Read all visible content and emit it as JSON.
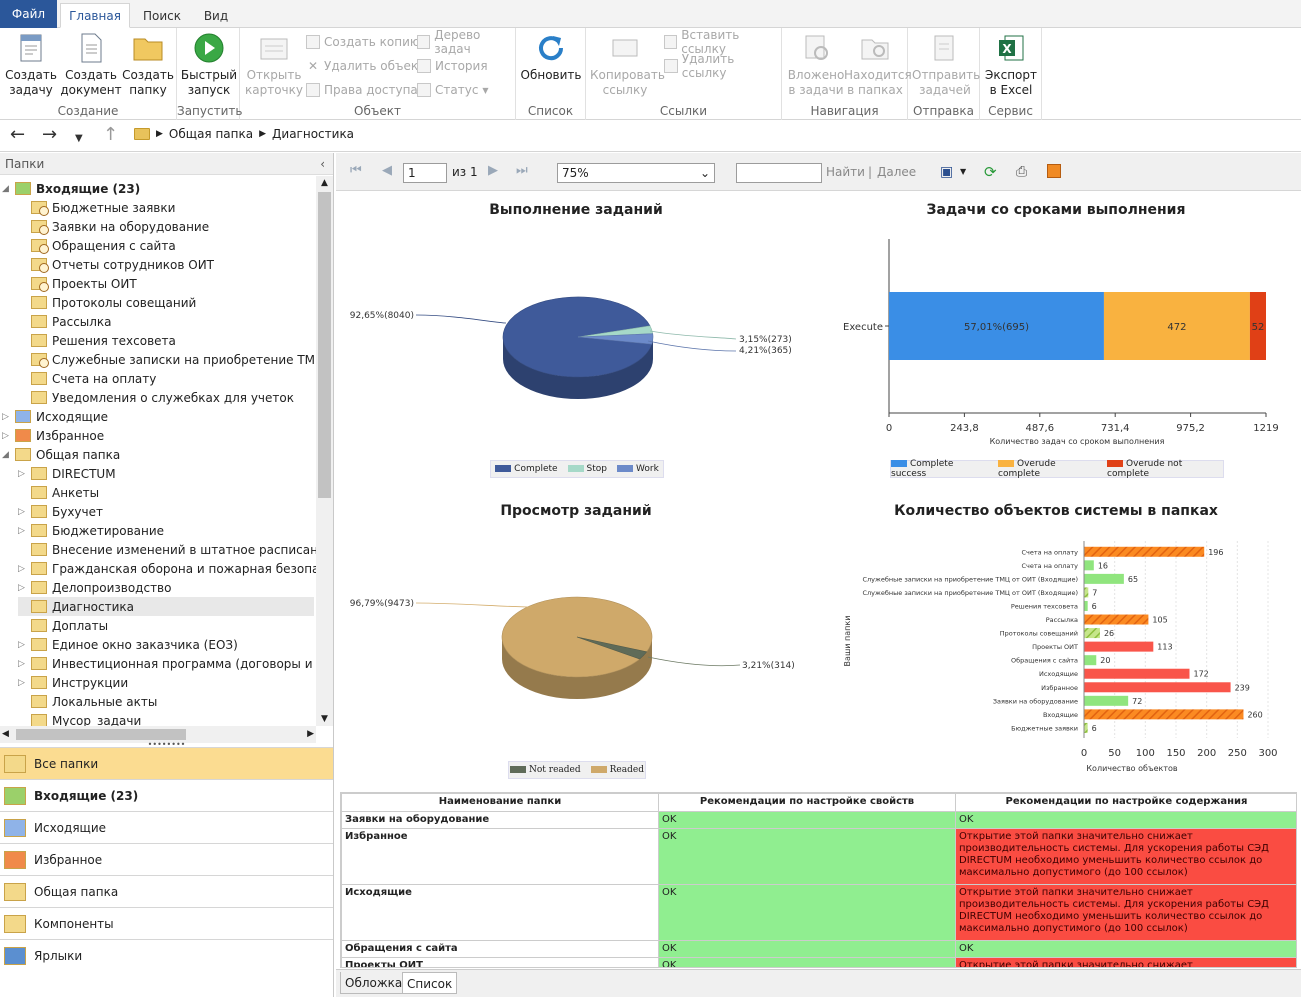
{
  "ribbon_tabs": {
    "file": "Файл",
    "home": "Главная",
    "search": "Поиск",
    "view": "Вид"
  },
  "ribbon": {
    "create_task": "Создать задачу",
    "create_doc": "Создать документ",
    "create_folder": "Создать папку",
    "group_create": "Создание",
    "quick_launch": "Быстрый запуск",
    "group_launch": "Запустить",
    "open_card": "Открыть карточку",
    "create_copy": "Создать копию",
    "delete_object": "Удалить объект",
    "access_rights": "Права доступа",
    "task_tree": "Дерево задач",
    "history": "История",
    "status": "Статус",
    "group_object": "Объект",
    "refresh": "Обновить",
    "group_list": "Список",
    "copy_link": "Копировать ссылку",
    "insert_link": "Вставить ссылку",
    "delete_link": "Удалить ссылку",
    "group_links": "Ссылки",
    "attached_to_tasks": "Вложено в задачи",
    "in_folders": "Находится в папках",
    "send_task": "Отправить задачей",
    "group_nav": "Навигация",
    "group_send": "Отправка",
    "export_excel": "Экспорт в Excel",
    "group_service": "Сервис"
  },
  "breadcrumb": [
    "Общая папка",
    "Диагностика"
  ],
  "left_pane": {
    "title": "Папки",
    "tree": [
      {
        "label": "Входящие (23)",
        "level": 0,
        "bold": true,
        "exp": "◢",
        "icon": "inbox"
      },
      {
        "label": "Бюджетные заявки",
        "level": 1,
        "icon": "clock"
      },
      {
        "label": "Заявки на оборудование",
        "level": 1,
        "icon": "clock"
      },
      {
        "label": "Обращения с сайта",
        "level": 1,
        "icon": "clock"
      },
      {
        "label": "Отчеты сотрудников ОИТ",
        "level": 1,
        "icon": "clock"
      },
      {
        "label": "Проекты ОИТ",
        "level": 1,
        "icon": "clock"
      },
      {
        "label": "Протоколы совещаний",
        "level": 1,
        "icon": "folder"
      },
      {
        "label": "Рассылка",
        "level": 1,
        "icon": "folder"
      },
      {
        "label": "Решения техсовета",
        "level": 1,
        "icon": "folder"
      },
      {
        "label": "Служебные записки на приобретение ТМЦ от О",
        "level": 1,
        "icon": "clock"
      },
      {
        "label": "Счета на оплату",
        "level": 1,
        "icon": "folder"
      },
      {
        "label": "Уведомления о служебках для учеток",
        "level": 1,
        "icon": "folder"
      },
      {
        "label": "Исходящие",
        "level": 0,
        "exp": "▷",
        "icon": "outbox"
      },
      {
        "label": "Избранное",
        "level": 0,
        "exp": "▷",
        "icon": "star"
      },
      {
        "label": "Общая папка",
        "level": 0,
        "exp": "◢",
        "icon": "folder"
      },
      {
        "label": "DIRECTUM",
        "level": 1,
        "exp": "▷",
        "icon": "folder"
      },
      {
        "label": "Анкеты",
        "level": 1,
        "icon": "folder"
      },
      {
        "label": "Бухучет",
        "level": 1,
        "exp": "▷",
        "icon": "folder"
      },
      {
        "label": "Бюджетирование",
        "level": 1,
        "exp": "▷",
        "icon": "folder"
      },
      {
        "label": "Внесение изменений в штатное расписание",
        "level": 1,
        "icon": "folder"
      },
      {
        "label": "Гражданская оборона и пожарная безопасност",
        "level": 1,
        "exp": "▷",
        "icon": "folder"
      },
      {
        "label": "Делопроизводство",
        "level": 1,
        "exp": "▷",
        "icon": "folder"
      },
      {
        "label": "Диагностика",
        "level": 1,
        "icon": "folder",
        "selected": true
      },
      {
        "label": "Доплаты",
        "level": 1,
        "icon": "folder"
      },
      {
        "label": "Единое окно заказчика (ЕОЗ)",
        "level": 1,
        "exp": "▷",
        "icon": "folder"
      },
      {
        "label": "Инвестиционная программа (договоры и прило",
        "level": 1,
        "exp": "▷",
        "icon": "folder"
      },
      {
        "label": "Инструкции",
        "level": 1,
        "exp": "▷",
        "icon": "folder"
      },
      {
        "label": "Локальные акты",
        "level": 1,
        "icon": "folder"
      },
      {
        "label": "Мусор_задачи",
        "level": 1,
        "icon": "folder"
      }
    ],
    "nav": [
      {
        "label": "Все папки",
        "active": true,
        "bold": false
      },
      {
        "label": "Входящие (23)",
        "active": false,
        "bold": true
      },
      {
        "label": "Исходящие",
        "active": false,
        "bold": false
      },
      {
        "label": "Избранное",
        "active": false,
        "bold": false
      },
      {
        "label": "Общая папка",
        "active": false,
        "bold": false
      },
      {
        "label": "Компоненты",
        "active": false,
        "bold": false
      },
      {
        "label": "Ярлыки",
        "active": false,
        "bold": false
      }
    ]
  },
  "report_toolbar": {
    "page": "1",
    "of": "из 1",
    "zoom": "75%",
    "find": "Найти",
    "sep": "|",
    "next": "Далее"
  },
  "chart_data": [
    {
      "type": "pie",
      "title": "Выполнение заданий",
      "slices": [
        {
          "name": "Complete",
          "value": 8040,
          "label": "92,65%(8040)",
          "color": "#3f5a9a"
        },
        {
          "name": "Stop",
          "value": 273,
          "label": "3,15%(273)",
          "color": "#a6d9c8"
        },
        {
          "name": "Work",
          "value": 365,
          "label": "4,21%(365)",
          "color": "#6c8ac9"
        }
      ]
    },
    {
      "type": "bar",
      "orientation": "horizontal",
      "stacked": true,
      "title": "Задачи со сроками выполнения",
      "categories": [
        "Execute"
      ],
      "series": [
        {
          "name": "Complete success",
          "values": [
            695
          ],
          "label": "57,01%(695)",
          "color": "#3a8ee6"
        },
        {
          "name": "Overude complete",
          "values": [
            472
          ],
          "label": "472",
          "color": "#f9b240"
        },
        {
          "name": "Overude not complete",
          "values": [
            52
          ],
          "label": "52",
          "color": "#e04016"
        }
      ],
      "xlabel": "Количество задач со сроком выполнения",
      "xticks": [
        "0",
        "243,8",
        "487,6",
        "731,4",
        "975,2",
        "1219"
      ],
      "xlim": [
        0,
        1219
      ]
    },
    {
      "type": "pie",
      "title": "Просмотр заданий",
      "slices": [
        {
          "name": "Readed",
          "value": 9473,
          "label": "96,79%(9473)",
          "color": "#cfa96a"
        },
        {
          "name": "Not readed",
          "value": 314,
          "label": "3,21%(314)",
          "color": "#5f6b58"
        }
      ]
    },
    {
      "type": "bar",
      "orientation": "horizontal",
      "title": "Количество объектов системы в папках",
      "ylabel": "Ваши папки",
      "xlabel": "Количество объектов",
      "xlim": [
        0,
        300
      ],
      "xticks": [
        "0",
        "50",
        "100",
        "150",
        "200",
        "250",
        "300"
      ],
      "categories": [
        "Счета на оплату",
        "Счета на оплату",
        "Служебные записки на приобретение ТМЦ от ОИТ (Входящие)",
        "Служебные записки на приобретение ТМЦ от ОИТ (Входящие)",
        "Решения техсовета",
        "Рассылка",
        "Протоколы совещаний",
        "Проекты ОИТ",
        "Обращения с сайта",
        "Исходящие",
        "Избранное",
        "Заявки на оборудование",
        "Входящие",
        "Бюджетные заявки"
      ],
      "values": [
        196,
        16,
        65,
        7,
        6,
        105,
        26,
        113,
        20,
        172,
        239,
        72,
        260,
        6
      ],
      "styles": [
        "orange-hatch",
        "green",
        "green",
        "green-hatch",
        "green",
        "orange-hatch",
        "green-hatch",
        "red",
        "green",
        "red",
        "red",
        "green",
        "orange-hatch",
        "green-hatch"
      ]
    }
  ],
  "legends": {
    "pie1": [
      "Complete",
      "Stop",
      "Work"
    ],
    "bar1": [
      "Complete success",
      "Overude complete",
      "Overude not complete"
    ],
    "pie2": [
      "Not readed",
      "Readed"
    ]
  },
  "table": {
    "headers": [
      "Наименование папки",
      "Рекомендации по настройке свойств",
      "Рекомендации по настройке содержания"
    ],
    "rows": [
      {
        "name": "Заявки на оборудование",
        "props": "OK",
        "content": "OK",
        "status": "ok"
      },
      {
        "name": "Избранное",
        "props": "OK",
        "content": "Открытие этой папки значительно снижает производительность системы. Для ускорения работы СЭД DIRECTUM необходимо уменьшить количество ссылок до максимально допустимого (до 100 ссылок)",
        "status": "bad"
      },
      {
        "name": "Исходящие",
        "props": "OK",
        "content": "Открытие этой папки значительно снижает производительность системы. Для ускорения работы СЭД DIRECTUM необходимо уменьшить количество ссылок до максимально допустимого (до 100 ссылок)",
        "status": "bad"
      },
      {
        "name": "Обращения с сайта",
        "props": "OK",
        "content": "OK",
        "status": "ok"
      },
      {
        "name": "Проекты ОИТ",
        "props": "OK",
        "content": "Открытие этой папки значительно снижает производительность системы",
        "status": "bad"
      }
    ]
  },
  "bottom_tabs": [
    "Обложка",
    "Список"
  ]
}
